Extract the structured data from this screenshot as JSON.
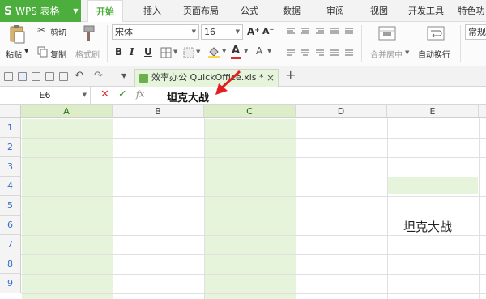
{
  "app": {
    "logo": "S",
    "title": "WPS 表格"
  },
  "menu": {
    "items": [
      "开始",
      "插入",
      "页面布局",
      "公式",
      "数据",
      "审阅",
      "视图",
      "开发工具",
      "特色功"
    ],
    "active": "开始"
  },
  "ribbon": {
    "paste": "粘贴",
    "cut": "剪切",
    "copy": "复制",
    "format_painter": "格式刷",
    "font_name": "宋体",
    "font_size": "16",
    "grow": "A⁺",
    "shrink": "A⁻",
    "bold": "B",
    "italic": "I",
    "underline": "U",
    "merge_center": "合并居中",
    "wrap_text": "自动换行",
    "number_format": "常规",
    "font_color": "#d32f2f",
    "accent": "#4cae3c"
  },
  "quickbar": {
    "doc_tab": "效率办公 QuickOffice.xls *",
    "close": "×",
    "add": "+"
  },
  "formula": {
    "cell_ref": "E6",
    "cancel": "✕",
    "confirm": "✓",
    "fx": "fx",
    "content": "坦克大战"
  },
  "grid": {
    "columns": [
      "A",
      "B",
      "C",
      "D",
      "E"
    ],
    "selected_columns": [
      "A",
      "C"
    ],
    "rows": [
      "1",
      "2",
      "3",
      "4",
      "5",
      "6",
      "7",
      "8",
      "9"
    ],
    "cell_e6": "坦克大战"
  }
}
